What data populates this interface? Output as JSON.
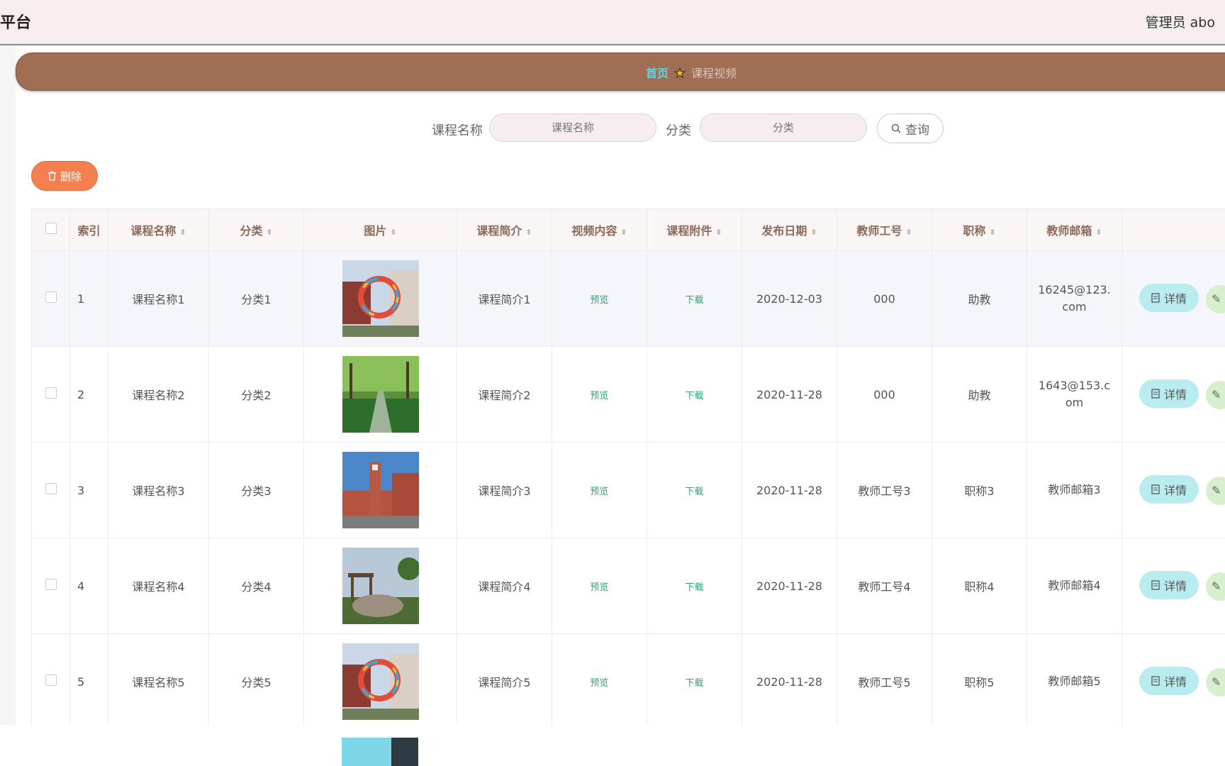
{
  "header": {
    "brand": "平台",
    "user": "管理员 abo"
  },
  "breadcrumb": {
    "home": "首页",
    "current": "课程视频"
  },
  "search": {
    "name_label": "课程名称",
    "name_placeholder": "课程名称",
    "category_label": "分类",
    "category_placeholder": "分类",
    "query_label": "查询"
  },
  "toolbar": {
    "delete_label": "删除"
  },
  "table": {
    "headers": [
      "索引",
      "课程名称",
      "分类",
      "图片",
      "课程简介",
      "视频内容",
      "课程附件",
      "发布日期",
      "教师工号",
      "职称",
      "教师邮箱"
    ],
    "rows": [
      {
        "index": "1",
        "name": "课程名称1",
        "category": "分类1",
        "intro": "课程简介1",
        "video": "预览",
        "attach": "下载",
        "date": "2020-12-03",
        "teacher_id": "000",
        "title": "助教",
        "email": "16245@123.com",
        "detail": "详情"
      },
      {
        "index": "2",
        "name": "课程名称2",
        "category": "分类2",
        "intro": "课程简介2",
        "video": "预览",
        "attach": "下载",
        "date": "2020-11-28",
        "teacher_id": "000",
        "title": "助教",
        "email": "1643@153.com",
        "detail": "详情"
      },
      {
        "index": "3",
        "name": "课程名称3",
        "category": "分类3",
        "intro": "课程简介3",
        "video": "预览",
        "attach": "下载",
        "date": "2020-11-28",
        "teacher_id": "教师工号3",
        "title": "职称3",
        "email": "教师邮箱3",
        "detail": "详情"
      },
      {
        "index": "4",
        "name": "课程名称4",
        "category": "分类4",
        "intro": "课程简介4",
        "video": "预览",
        "attach": "下载",
        "date": "2020-11-28",
        "teacher_id": "教师工号4",
        "title": "职称4",
        "email": "教师邮箱4",
        "detail": "详情"
      },
      {
        "index": "5",
        "name": "课程名称5",
        "category": "分类5",
        "intro": "课程简介5",
        "video": "预览",
        "attach": "下载",
        "date": "2020-11-28",
        "teacher_id": "教师工号5",
        "title": "职称5",
        "email": "教师邮箱5",
        "detail": "详情"
      }
    ]
  },
  "colors": {
    "crumb_bar": "#a06e55",
    "delete_button": "#f5804f",
    "detail_button": "#b8ecef",
    "link_green": "#29a86a",
    "crumb_home": "#62d6e8"
  }
}
